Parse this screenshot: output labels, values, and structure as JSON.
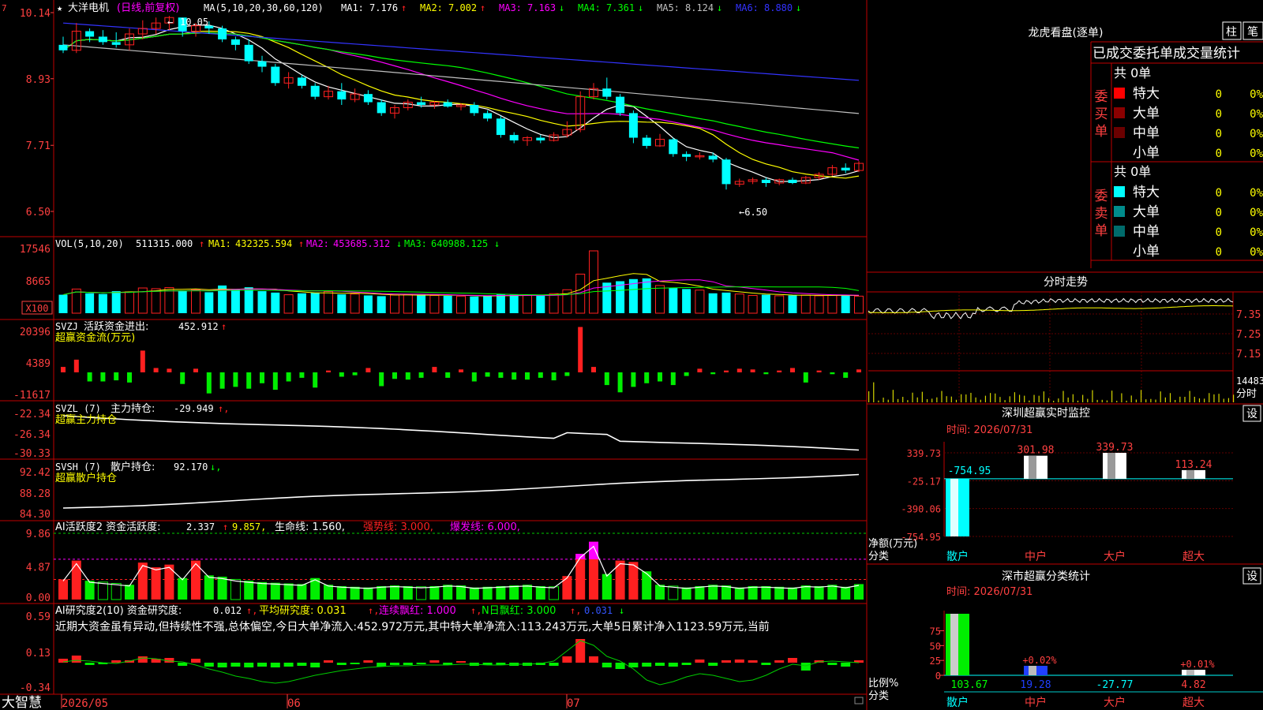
{
  "stock": {
    "name": "大洋电机",
    "period": "(日线,前复权)",
    "high_note": "10.05",
    "low_note": "←6.50"
  },
  "main_panel": {
    "ma_label": "MA(5,10,20,30,60,120)",
    "ma": [
      {
        "name": "MA1:",
        "value": "7.176",
        "arrow": "↑",
        "color": "#ffffff"
      },
      {
        "name": "MA2:",
        "value": "7.002",
        "arrow": "↑",
        "color": "#ffff00"
      },
      {
        "name": "MA3:",
        "value": "7.163",
        "arrow": "↓",
        "color": "#ff00ff"
      },
      {
        "name": "MA4:",
        "value": "7.361",
        "arrow": "↓",
        "color": "#00ff00"
      },
      {
        "name": "MA5:",
        "value": "8.124",
        "arrow": "↓",
        "color": "#c0c0c0"
      },
      {
        "name": "MA6:",
        "value": "8.880",
        "arrow": "↓",
        "color": "#3333ff"
      }
    ],
    "ticks": [
      "10.14",
      "8.93",
      "7.71",
      "6.50"
    ]
  },
  "vol_panel": {
    "label": "VOL(5,10,20)",
    "value": "511315.000",
    "items": [
      {
        "name": "MA1:",
        "value": "432325.594",
        "arrow": "↑",
        "color": "#ffff00"
      },
      {
        "name": "MA2:",
        "value": "453685.312",
        "arrow": "↓",
        "color": "#ff00ff"
      },
      {
        "name": "MA3:",
        "value": "640988.125",
        "arrow": "↓",
        "color": "#00ff00"
      }
    ],
    "ticks": [
      "17546",
      "8665",
      "X100"
    ]
  },
  "svzj_panel": {
    "label": "SVZJ  活跃资金进出:",
    "value": "452.912",
    "sub": "超赢资金流(万元)",
    "ticks": [
      "20396",
      "4389",
      "-11617"
    ]
  },
  "svzl_panel": {
    "label": "SVZL (7) 主力持仓:",
    "value": "-29.949",
    "sub": "超赢主力持仓",
    "ticks": [
      "-22.34",
      "-26.34",
      "-30.33"
    ]
  },
  "svsh_panel": {
    "label": "SVSH (7) 散户持仓:",
    "value": "92.170",
    "sub": "超赢散户持仓",
    "ticks": [
      "92.42",
      "88.28",
      "84.30"
    ]
  },
  "ai_active_panel": {
    "label": "AI活跃度2 资金活跃度:",
    "value": "2.337",
    "v2": "9.857,",
    "life": "生命线: 1.560,",
    "strong": "强势线: 3.000,",
    "burst": "爆发线: 6.000,",
    "ticks": [
      "9.86",
      "4.87",
      "0.00"
    ]
  },
  "ai_research_panel": {
    "label": "AI研究度2(10)  资金研究度:",
    "value": "0.012",
    "avg": "平均研究度: 0.031",
    "lianxu": "连续飘红: 1.000",
    "nri": "N日飘红: 3.000",
    "last": "0.031",
    "comment": "近期大资金虽有异动,但持续性不强,总体偏空,今日大单净流入:452.972万元,其中特大单净流入:113.243万元,大单5日累计净入1123.59万元,当前",
    "ticks": [
      "0.59",
      "0.13",
      "-0.34"
    ]
  },
  "bottom_axis": {
    "brand": "大智慧",
    "labels": [
      "2026/05",
      "06",
      "07"
    ]
  },
  "right_panel": {
    "title": "龙虎看盘(逐单)",
    "btn1": "柱",
    "btn2": "笔",
    "stat_title": "已成交委托单成交量统计",
    "buy_label": "委买单",
    "sell_label": "委卖单",
    "buy_total": "共 0单",
    "sell_total": "共 0单",
    "buy_rows": [
      {
        "name": "特大",
        "qty": "0",
        "pct": "0%",
        "color": "#ff0000"
      },
      {
        "name": "大单",
        "qty": "0",
        "pct": "0%",
        "color": "#8b0000"
      },
      {
        "name": "中单",
        "qty": "0",
        "pct": "0%",
        "color": "#6b0000"
      },
      {
        "name": "小单",
        "qty": "0",
        "pct": "0%",
        "color": ""
      }
    ],
    "sell_rows": [
      {
        "name": "特大",
        "qty": "0",
        "pct": "0%",
        "color": "#00ffff"
      },
      {
        "name": "大单",
        "qty": "0",
        "pct": "0%",
        "color": "#008b8b"
      },
      {
        "name": "中单",
        "qty": "0",
        "pct": "0%",
        "color": "#006b6b"
      },
      {
        "name": "小单",
        "qty": "0",
        "pct": "0%",
        "color": ""
      }
    ]
  },
  "intraday": {
    "title": "分时走势",
    "ticks": [
      "7.35",
      "7.25",
      "7.15"
    ],
    "vol_tick": "14483",
    "vol_unit": "分时"
  },
  "sz_monitor": {
    "title": "深圳超赢实时监控",
    "btn": "设",
    "time": "时间: 2026/07/31",
    "ticks": [
      "339.73",
      "-25.17",
      "-390.06",
      "-754.95"
    ],
    "unit": "净额(万元)",
    "cat_label": "分类",
    "categories": [
      "散户",
      "中户",
      "大户",
      "超大"
    ],
    "values": [
      -754.95,
      301.98,
      339.73,
      113.24
    ],
    "value_labels": [
      "-754.95",
      "301.98",
      "339.73",
      "113.24"
    ]
  },
  "sz_class": {
    "title": "深市超赢分类统计",
    "btn": "设",
    "time": "时间: 2026/07/31",
    "ticks": [
      "75",
      "50",
      "25",
      "0"
    ],
    "unit": "比例%",
    "cat_label": "分类",
    "categories": [
      "散户",
      "中户",
      "大户",
      "超大"
    ],
    "values": [
      103.67,
      19.28,
      -27.77,
      4.82
    ],
    "value_labels": [
      "103.67",
      "19.28",
      "-27.77",
      "4.82"
    ],
    "top_labels": [
      "",
      "+0.02%",
      "",
      "+0.01%"
    ]
  },
  "chart_data": [
    {
      "type": "candlestick",
      "series": [
        {
          "name": "MA1",
          "color": "#ffffff"
        },
        {
          "name": "MA2",
          "color": "#ffff00"
        },
        {
          "name": "MA3",
          "color": "#ff00ff"
        },
        {
          "name": "MA4",
          "color": "#00ff00"
        },
        {
          "name": "MA5",
          "color": "#c0c0c0"
        },
        {
          "name": "MA6",
          "color": "#3333ff"
        }
      ],
      "ylim": [
        6.5,
        10.14
      ],
      "ohlc": [
        [
          9.55,
          9.7,
          9.4,
          9.45
        ],
        [
          9.45,
          9.95,
          9.4,
          9.8
        ],
        [
          9.8,
          9.85,
          9.6,
          9.7
        ],
        [
          9.7,
          9.82,
          9.55,
          9.6
        ],
        [
          9.6,
          9.78,
          9.5,
          9.55
        ],
        [
          9.55,
          9.85,
          9.45,
          9.75
        ],
        [
          9.75,
          10.0,
          9.65,
          9.85
        ],
        [
          9.85,
          10.05,
          9.75,
          9.95
        ],
        [
          9.95,
          10.08,
          9.82,
          10.05
        ],
        [
          10.05,
          10.05,
          9.7,
          9.8
        ],
        [
          9.8,
          9.95,
          9.7,
          9.9
        ],
        [
          9.9,
          9.98,
          9.75,
          9.85
        ],
        [
          9.85,
          9.9,
          9.6,
          9.65
        ],
        [
          9.65,
          9.7,
          9.45,
          9.55
        ],
        [
          9.55,
          9.65,
          9.2,
          9.25
        ],
        [
          9.25,
          9.35,
          9.05,
          9.15
        ],
        [
          9.15,
          9.2,
          8.8,
          8.85
        ],
        [
          8.85,
          9.05,
          8.75,
          8.95
        ],
        [
          8.95,
          9.0,
          8.75,
          8.8
        ],
        [
          8.8,
          8.85,
          8.55,
          8.6
        ],
        [
          8.6,
          8.8,
          8.55,
          8.7
        ],
        [
          8.7,
          8.85,
          8.45,
          8.55
        ],
        [
          8.55,
          8.75,
          8.5,
          8.65
        ],
        [
          8.65,
          8.72,
          8.45,
          8.5
        ],
        [
          8.5,
          8.55,
          8.25,
          8.3
        ],
        [
          8.3,
          8.45,
          8.2,
          8.4
        ],
        [
          8.4,
          8.55,
          8.35,
          8.5
        ],
        [
          8.5,
          8.6,
          8.4,
          8.45
        ],
        [
          8.45,
          8.52,
          8.38,
          8.5
        ],
        [
          8.5,
          8.55,
          8.4,
          8.42
        ],
        [
          8.42,
          8.48,
          8.35,
          8.45
        ],
        [
          8.45,
          8.5,
          8.25,
          8.3
        ],
        [
          8.3,
          8.35,
          8.15,
          8.2
        ],
        [
          8.2,
          8.25,
          7.85,
          7.9
        ],
        [
          7.9,
          7.95,
          7.75,
          7.8
        ],
        [
          7.8,
          7.88,
          7.7,
          7.85
        ],
        [
          7.85,
          7.9,
          7.75,
          7.8
        ],
        [
          7.8,
          7.95,
          7.78,
          7.9
        ],
        [
          7.9,
          8.15,
          7.85,
          8.0
        ],
        [
          8.0,
          8.7,
          7.95,
          8.6
        ],
        [
          8.6,
          8.85,
          8.55,
          8.75
        ],
        [
          8.75,
          8.95,
          8.55,
          8.6
        ],
        [
          8.6,
          8.65,
          8.25,
          8.3
        ],
        [
          8.3,
          8.35,
          7.75,
          7.85
        ],
        [
          7.85,
          7.9,
          7.65,
          7.7
        ],
        [
          7.7,
          7.92,
          7.68,
          7.82
        ],
        [
          7.82,
          7.85,
          7.5,
          7.55
        ],
        [
          7.55,
          7.6,
          7.42,
          7.5
        ],
        [
          7.5,
          7.58,
          7.45,
          7.52
        ],
        [
          7.52,
          7.58,
          7.4,
          7.45
        ],
        [
          7.45,
          7.48,
          6.9,
          7.0
        ],
        [
          7.0,
          7.1,
          6.95,
          7.05
        ],
        [
          7.05,
          7.12,
          7.0,
          7.08
        ],
        [
          7.08,
          7.12,
          6.95,
          7.02
        ],
        [
          7.02,
          7.1,
          6.98,
          7.08
        ],
        [
          7.08,
          7.12,
          7.0,
          7.02
        ],
        [
          7.02,
          7.15,
          7.0,
          7.12
        ],
        [
          7.12,
          7.22,
          7.08,
          7.18
        ],
        [
          7.18,
          7.35,
          7.15,
          7.3
        ],
        [
          7.3,
          7.38,
          7.2,
          7.25
        ],
        [
          7.25,
          7.42,
          7.22,
          7.38
        ]
      ]
    }
  ]
}
